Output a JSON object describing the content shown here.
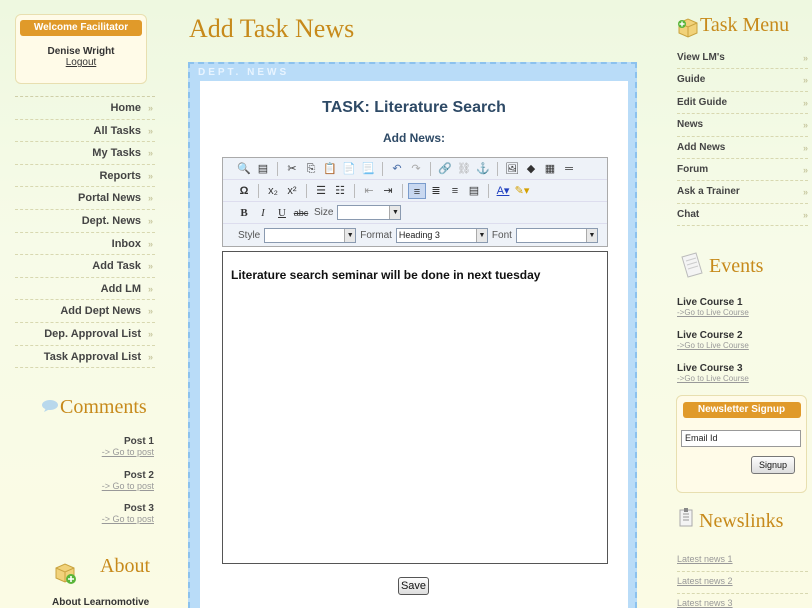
{
  "welcome": {
    "title": "Welcome Facilitator",
    "user": "Denise Wright",
    "logout": "Logout"
  },
  "left_nav": [
    "Home",
    "All Tasks",
    "My Tasks",
    "Reports",
    "Portal News",
    "Dept. News",
    "Inbox",
    "Add Task",
    "Add LM",
    "Add Dept News",
    "Dep. Approval List",
    "Task Approval List"
  ],
  "comments": {
    "title": "Comments",
    "posts": [
      {
        "title": "Post 1",
        "link": "-> Go to post"
      },
      {
        "title": "Post 2",
        "link": "-> Go to post"
      },
      {
        "title": "Post 3",
        "link": "-> Go to post"
      }
    ]
  },
  "about": {
    "title": "About",
    "text": "About Learnomotive"
  },
  "main": {
    "page_title": "Add Task News",
    "frame_label": "DEPT. NEWS",
    "task_title": "TASK: Literature Search",
    "add_news_label": "Add News:",
    "editor": {
      "size_label": "Size",
      "size_value": "",
      "style_label": "Style",
      "style_value": "",
      "format_label": "Format",
      "format_value": "Heading 3",
      "font_label": "Font",
      "font_value": "",
      "content": "Literature search seminar will be done in next tuesday"
    },
    "save_label": "Save"
  },
  "task_menu": {
    "title": "Task Menu",
    "items": [
      "View LM's",
      "Guide",
      "Edit Guide",
      "News",
      "Add News",
      "Forum",
      "Ask a Trainer",
      "Chat"
    ]
  },
  "events": {
    "title": "Events",
    "items": [
      {
        "title": "Live Course 1",
        "link": "->Go to Live Course"
      },
      {
        "title": "Live Course 2",
        "link": "->Go to Live Course"
      },
      {
        "title": "Live Course 3",
        "link": "->Go to Live Course"
      }
    ]
  },
  "newsletter": {
    "title": "Newsletter Signup",
    "email_value": "Email Id",
    "signup_label": "Signup"
  },
  "newslinks": {
    "title": "Newslinks",
    "items": [
      "Latest news 1",
      "Latest news 2",
      "Latest news 3"
    ]
  },
  "colors": {
    "accent": "#c78a1b",
    "badge": "#e09a2a",
    "panel": "#b9dcf8"
  }
}
